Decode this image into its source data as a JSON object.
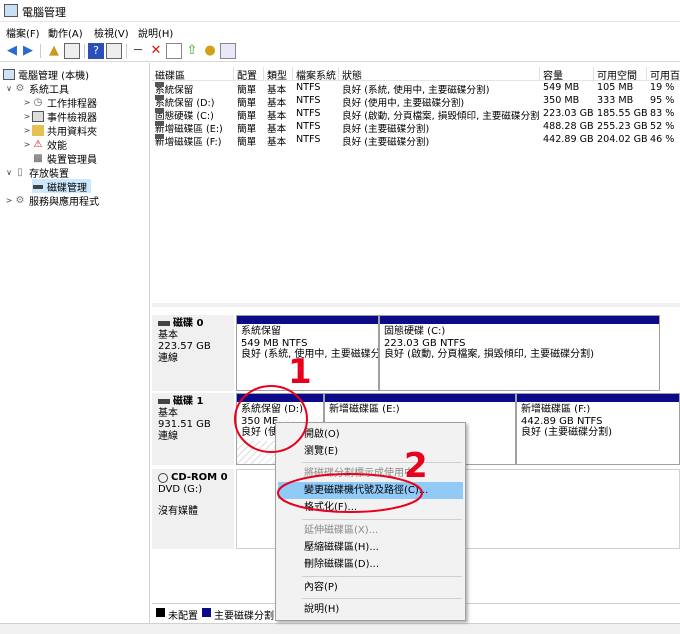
{
  "window": {
    "title": "電腦管理"
  },
  "menu": [
    "檔案(F)",
    "動作(A)",
    "檢視(V)",
    "說明(H)"
  ],
  "tree": {
    "root": "電腦管理 (本機)",
    "system_tools": "系統工具",
    "task_scheduler": "工作排程器",
    "event_viewer": "事件檢視器",
    "shared_folders": "共用資料夾",
    "performance": "效能",
    "device_manager": "裝置管理員",
    "storage": "存放裝置",
    "disk_management": "磁碟管理",
    "services": "服務與應用程式"
  },
  "volume_table": {
    "columns": [
      "磁碟區",
      "配置",
      "類型",
      "檔案系統",
      "狀態",
      "容量",
      "可用空間",
      "可用百"
    ],
    "rows": [
      [
        "系統保留",
        "簡單",
        "基本",
        "NTFS",
        "良好 (系統, 使用中, 主要磁碟分割)",
        "549 MB",
        "105 MB",
        "19 %"
      ],
      [
        "系統保留 (D:)",
        "簡單",
        "基本",
        "NTFS",
        "良好 (使用中, 主要磁碟分割)",
        "350 MB",
        "333 MB",
        "95 %"
      ],
      [
        "固態硬碟 (C:)",
        "簡單",
        "基本",
        "NTFS",
        "良好 (啟動, 分頁檔案, 損毀傾印, 主要磁碟分割)",
        "223.03 GB",
        "185.55 GB",
        "83 %"
      ],
      [
        "新增磁碟區 (E:)",
        "簡單",
        "基本",
        "NTFS",
        "良好 (主要磁碟分割)",
        "488.28 GB",
        "255.23 GB",
        "52 %"
      ],
      [
        "新增磁碟區 (F:)",
        "簡單",
        "基本",
        "NTFS",
        "良好 (主要磁碟分割)",
        "442.89 GB",
        "204.02 GB",
        "46 %"
      ]
    ]
  },
  "disks": {
    "disk0": {
      "name": "磁碟 0",
      "type": "基本",
      "size": "223.57 GB",
      "status": "連線",
      "p1": {
        "title": "系統保留",
        "size": "549 MB NTFS",
        "status": "良好 (系統, 使用中, 主要磁碟分割)"
      },
      "p2": {
        "title": "固態硬碟  (C:)",
        "size": "223.03 GB NTFS",
        "status": "良好 (啟動, 分頁檔案, 損毀傾印, 主要磁碟分割)"
      }
    },
    "disk1": {
      "name": "磁碟 1",
      "type": "基本",
      "size": "931.51 GB",
      "status": "連線",
      "p1": {
        "title": "系統保留  (D:)",
        "size": "350 ME",
        "status": "良好 (使"
      },
      "p2": {
        "title": "新增磁碟區  (E:)",
        "size": "",
        "status": ""
      },
      "p3": {
        "title": "新增磁碟區  (F:)",
        "size": "442.89 GB NTFS",
        "status": "良好 (主要磁碟分割)"
      }
    },
    "cdrom": {
      "name": "CD-ROM 0",
      "type": "DVD (G:)",
      "status": "沒有媒體"
    }
  },
  "legend": {
    "unallocated": "未配置",
    "primary": "主要磁碟分割"
  },
  "context_menu": {
    "open": "開啟(O)",
    "explore": "瀏覽(E)",
    "mark_active": "將磁碟分割標示成使用中",
    "change_letter": "變更磁碟機代號及路徑(C)...",
    "format": "格式化(F)...",
    "extend": "延伸磁碟區(X)...",
    "shrink": "壓縮磁碟區(H)...",
    "delete": "刪除磁碟區(D)...",
    "properties": "內容(P)",
    "help": "說明(H)"
  },
  "annotations": {
    "label1": "1",
    "label2": "2"
  },
  "colors": {
    "primary_partition": "#0a0a8a",
    "highlight": "#91c9f7",
    "annotation": "#e8001c"
  }
}
